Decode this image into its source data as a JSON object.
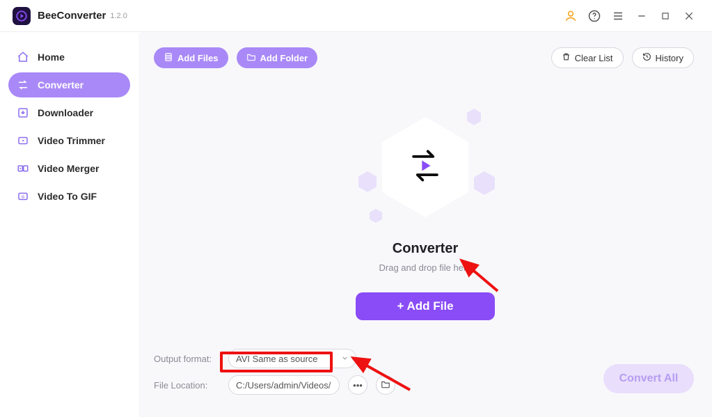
{
  "app": {
    "name": "BeeConverter",
    "version": "1.2.0"
  },
  "sidebar": {
    "items": [
      {
        "label": "Home",
        "icon": "home-icon"
      },
      {
        "label": "Converter",
        "icon": "converter-icon",
        "active": true
      },
      {
        "label": "Downloader",
        "icon": "download-icon"
      },
      {
        "label": "Video Trimmer",
        "icon": "trimmer-icon"
      },
      {
        "label": "Video Merger",
        "icon": "merger-icon"
      },
      {
        "label": "Video To GIF",
        "icon": "gif-icon"
      }
    ]
  },
  "toolbar": {
    "add_files_label": "Add Files",
    "add_folder_label": "Add Folder",
    "clear_list_label": "Clear List",
    "history_label": "History"
  },
  "main": {
    "title": "Converter",
    "subtitle": "Drag and drop file here",
    "add_file_label": "+ Add File"
  },
  "output": {
    "format_label": "Output format:",
    "format_value": "AVI Same as source",
    "location_label": "File Location:",
    "location_value": "C:/Users/admin/Videos/"
  },
  "actions": {
    "convert_all_label": "Convert All"
  },
  "colors": {
    "accent": "#8a4cf6",
    "accent_soft": "#a989f7"
  }
}
